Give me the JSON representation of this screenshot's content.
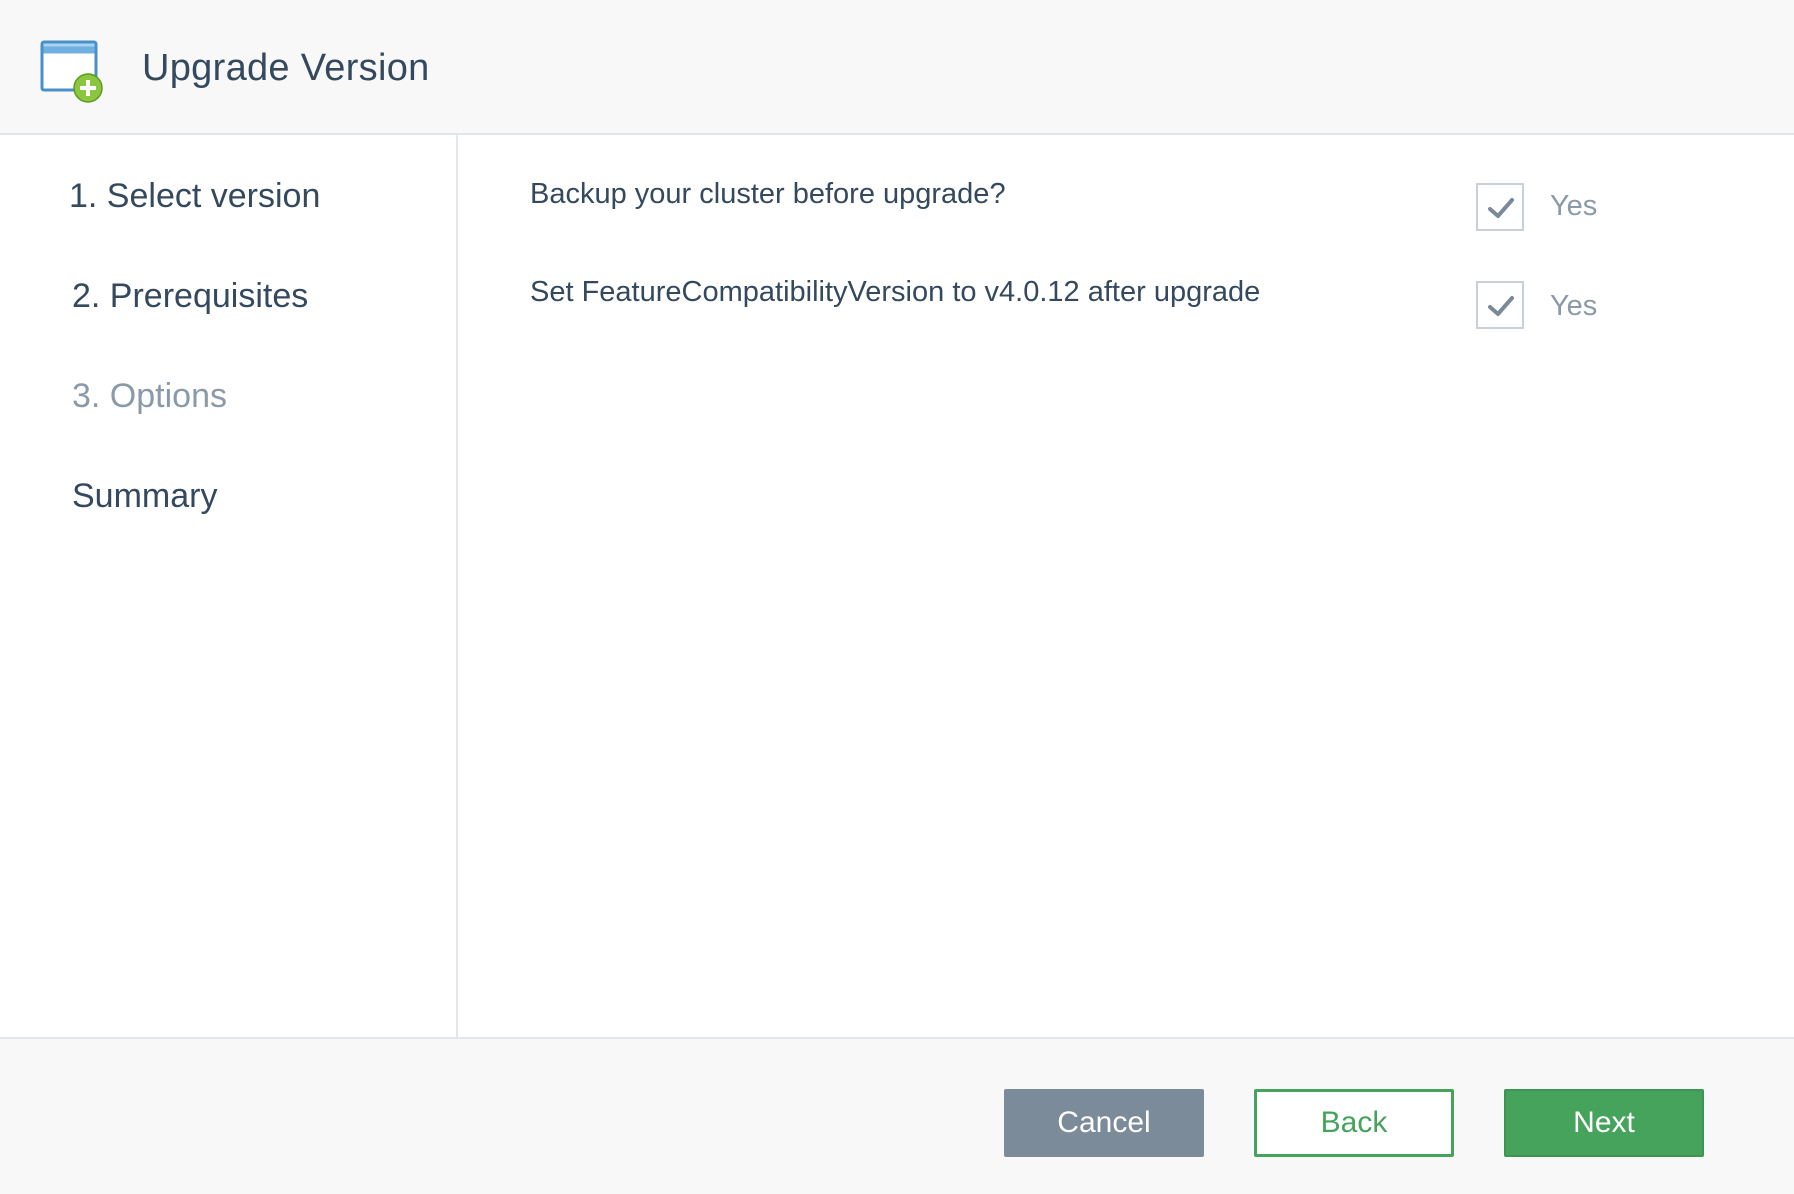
{
  "header": {
    "title": "Upgrade Version",
    "icon": "add-window-icon"
  },
  "steps": [
    {
      "label": "1. Select version",
      "state": "completed"
    },
    {
      "label": "2. Prerequisites",
      "state": "completed"
    },
    {
      "label": "3. Options",
      "state": "current"
    },
    {
      "label": "Summary",
      "state": "pending"
    }
  ],
  "options": [
    {
      "label": "Backup your cluster before upgrade?",
      "checked": true,
      "check_label": "Yes"
    },
    {
      "label": "Set FeatureCompatibilityVersion to v4.0.12 after upgrade",
      "checked": true,
      "check_label": "Yes"
    }
  ],
  "footer": {
    "cancel_label": "Cancel",
    "back_label": "Back",
    "next_label": "Next"
  },
  "colors": {
    "primary_green": "#45a35c",
    "cancel_gray": "#7b8b9a",
    "text_dark": "#34495e",
    "text_muted": "#8a9aa8"
  }
}
